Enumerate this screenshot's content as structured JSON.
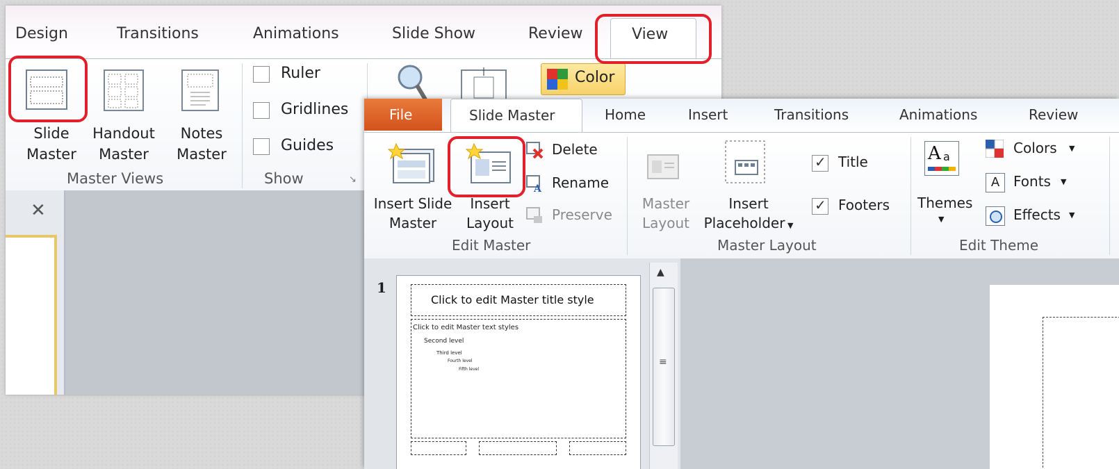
{
  "back": {
    "tabs": [
      "Design",
      "Transitions",
      "Animations",
      "Slide Show",
      "Review",
      "View"
    ],
    "master_views": {
      "slide_master": [
        "Slide",
        "Master"
      ],
      "handout_master": [
        "Handout",
        "Master"
      ],
      "notes_master": [
        "Notes",
        "Master"
      ],
      "group_label": "Master Views"
    },
    "show": {
      "ruler": "Ruler",
      "gridlines": "Gridlines",
      "guides": "Guides",
      "group_label": "Show"
    },
    "color_button": "Color",
    "close_glyph": "✕"
  },
  "front": {
    "tabs": {
      "file": "File",
      "slide_master": "Slide Master",
      "home": "Home",
      "insert": "Insert",
      "transitions": "Transitions",
      "animations": "Animations",
      "review": "Review"
    },
    "edit_master": {
      "insert_slide_master": [
        "Insert Slide",
        "Master"
      ],
      "insert_layout": [
        "Insert",
        "Layout"
      ],
      "delete": "Delete",
      "rename": "Rename",
      "preserve": "Preserve",
      "group_label": "Edit Master"
    },
    "master_layout": {
      "master_layout": [
        "Master",
        "Layout"
      ],
      "insert_placeholder": [
        "Insert",
        "Placeholder"
      ],
      "title_checkbox": "Title",
      "footers_checkbox": "Footers",
      "group_label": "Master Layout"
    },
    "edit_theme": {
      "themes": "Themes",
      "colors": "Colors",
      "fonts": "Fonts",
      "effects": "Effects",
      "group_label": "Edit Theme"
    },
    "thumbnail": {
      "number": "1",
      "title": "Click to edit Master title style",
      "levels": [
        "Click to edit Master text styles",
        "Second level",
        "Third level",
        "Fourth level",
        "Fifth level"
      ]
    }
  }
}
